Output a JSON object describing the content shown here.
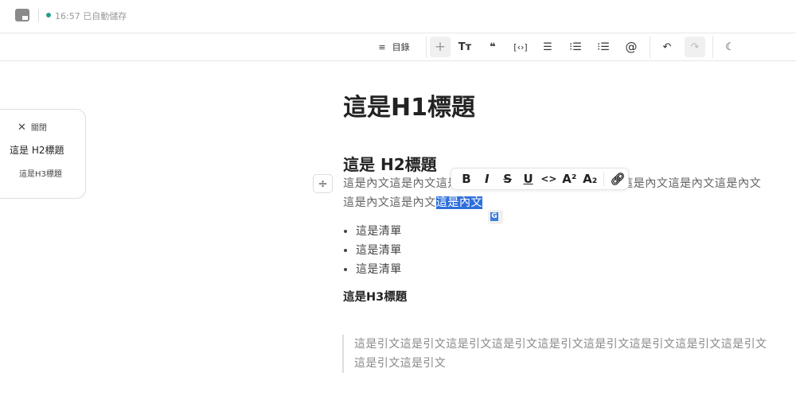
{
  "header": {
    "status_time": "16:57",
    "status_text": "已自動儲存",
    "status_color": "#2a9d8f"
  },
  "toolbar": {
    "toc_label": "目錄",
    "items": [
      "add",
      "text-size",
      "quote",
      "code-block",
      "align-center",
      "bullet-list",
      "ordered-list",
      "mention",
      "undo",
      "redo",
      "dark-mode"
    ]
  },
  "toc_panel": {
    "close_label": "關閉",
    "h2": "這是 H2標題",
    "h3": "這是H3標題"
  },
  "doc": {
    "h1": "這是H1標題",
    "h2": "這是 H2標題",
    "paragraph": "這是內文這是內文這是內文這是內文這是內文這是內文這是內文這是內文這是內文這是內文這是內文",
    "selected": "這是內文",
    "list": [
      "這是清單",
      "這是清單",
      "這是清單"
    ],
    "h3": "這是H3標題",
    "quote": "這是引文這是引文這是引文這是引文這是引文這是引文這是引文這是引文這是引文這是引文這是引文"
  },
  "format_toolbar": {
    "bold": "B",
    "italic": "I",
    "strike": "S",
    "underline": "U",
    "code": "<>",
    "superscript": "A²",
    "subscript": "A₂"
  },
  "selection_color": "#2f6fdb"
}
